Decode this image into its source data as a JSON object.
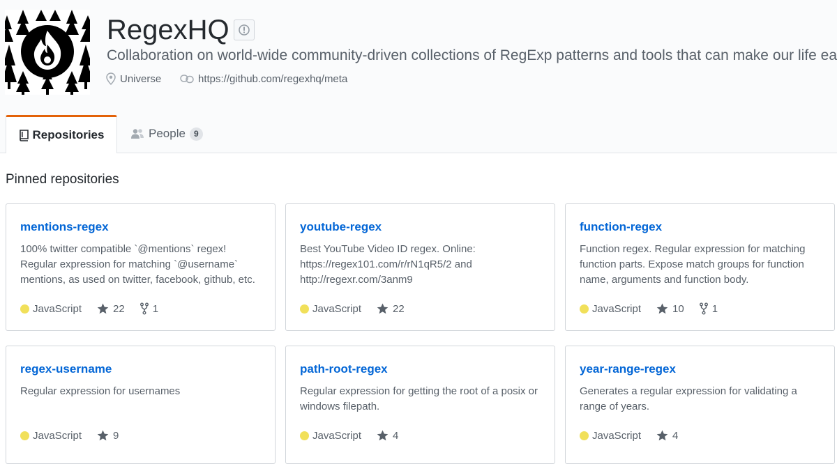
{
  "org": {
    "name": "RegexHQ",
    "description": "Collaboration on world-wide community-driven collections of RegExp patterns and tools that can make our life easier.",
    "location": "Universe",
    "url": "https://github.com/regexhq/meta"
  },
  "tabs": {
    "repositories": "Repositories",
    "people": "People",
    "people_count": "9"
  },
  "pinned": {
    "title": "Pinned repositories",
    "repos": [
      {
        "name": "mentions-regex",
        "description": "100% twitter compatible `@mentions` regex! Regular expression for matching `@username` mentions, as used on twitter, facebook, github, etc.",
        "language": "JavaScript",
        "stars": "22",
        "forks": "1"
      },
      {
        "name": "youtube-regex",
        "description": "Best YouTube Video ID regex. Online: https://regex101.com/r/rN1qR5/2 and http://regexr.com/3anm9",
        "language": "JavaScript",
        "stars": "22",
        "forks": null
      },
      {
        "name": "function-regex",
        "description": "Function regex. Regular expression for matching function parts. Expose match groups for function name, arguments and function body.",
        "language": "JavaScript",
        "stars": "10",
        "forks": "1"
      },
      {
        "name": "regex-username",
        "description": "Regular expression for usernames",
        "language": "JavaScript",
        "stars": "9",
        "forks": null
      },
      {
        "name": "path-root-regex",
        "description": "Regular expression for getting the root of a posix or windows filepath.",
        "language": "JavaScript",
        "stars": "4",
        "forks": null
      },
      {
        "name": "year-range-regex",
        "description": "Generates a regular expression for validating a range of years.",
        "language": "JavaScript",
        "stars": "4",
        "forks": null
      }
    ]
  },
  "colors": {
    "accent_tab": "#e36209",
    "link": "#0366d6",
    "javascript": "#f1e05a"
  }
}
